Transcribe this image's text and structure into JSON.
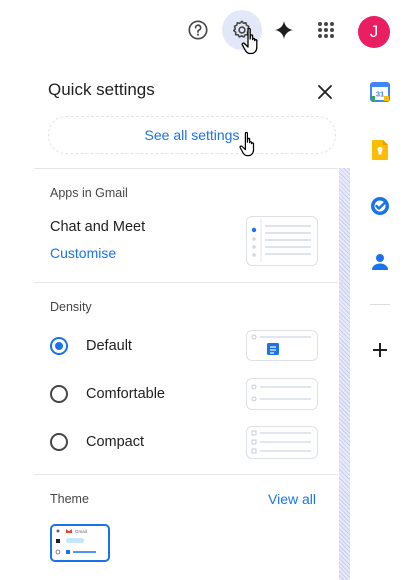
{
  "topbar": {
    "help_icon": "help-circle-icon",
    "settings_icon": "gear-icon",
    "gemini_icon": "gemini-sparkle-icon",
    "apps_icon": "apps-grid-icon",
    "avatar_initial": "J",
    "avatar_color": "#e91e63"
  },
  "panel": {
    "title": "Quick settings",
    "see_all": "See all settings",
    "apps_section": {
      "heading": "Apps in Gmail",
      "label": "Chat and Meet",
      "link": "Customise"
    },
    "density": {
      "heading": "Density",
      "options": [
        {
          "label": "Default",
          "selected": true
        },
        {
          "label": "Comfortable",
          "selected": false
        },
        {
          "label": "Compact",
          "selected": false
        }
      ]
    },
    "theme": {
      "heading": "Theme",
      "view_all": "View all",
      "thumb_label": "Gmail"
    }
  },
  "siderail": {
    "calendar_day": "31",
    "icons": [
      "calendar-icon",
      "keep-icon",
      "tasks-icon",
      "contacts-icon",
      "add-icon"
    ]
  },
  "colors": {
    "accent": "#1a73e8",
    "gear_highlight": "#e3e8f8"
  }
}
